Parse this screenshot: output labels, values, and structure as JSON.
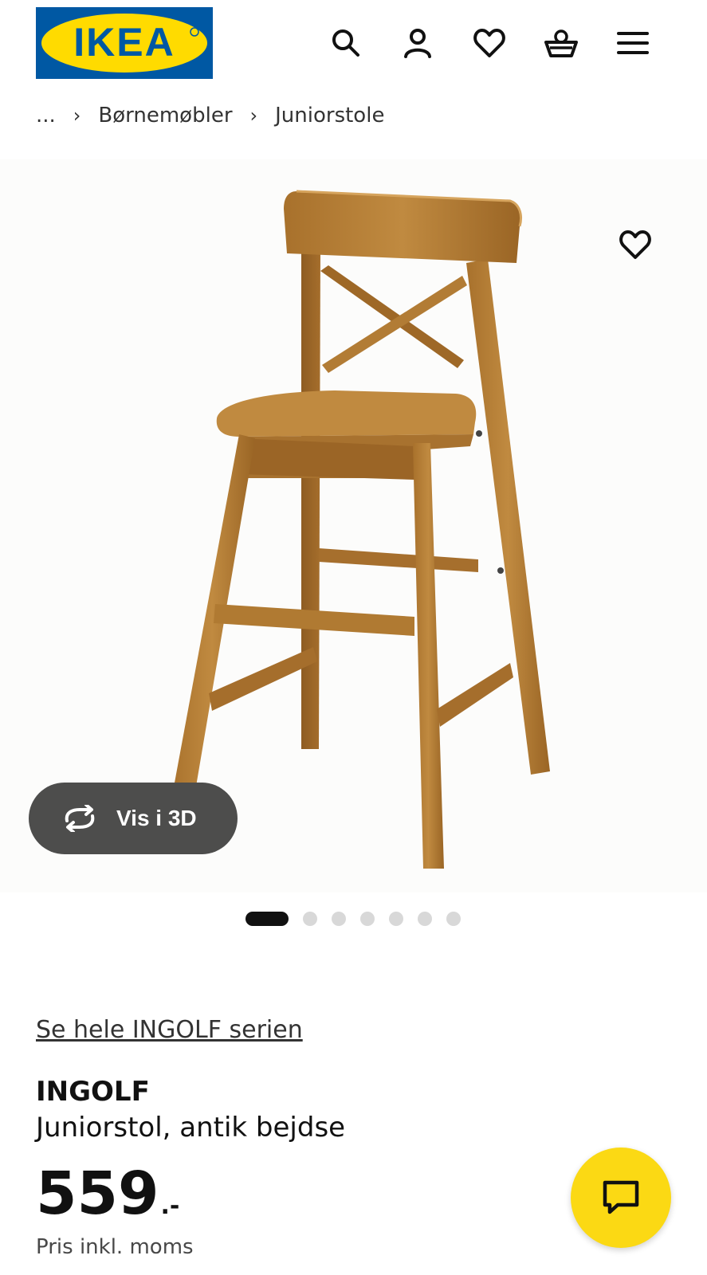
{
  "brand": {
    "logo_text": "IKEA",
    "colors": {
      "blue": "#0058a3",
      "yellow": "#ffdb00"
    }
  },
  "header": {
    "icons": [
      "search-icon",
      "account-icon",
      "heart-icon",
      "basket-icon",
      "menu-icon"
    ]
  },
  "breadcrumb": {
    "ellipsis": "...",
    "items": [
      "Børnemøbler",
      "Juniorstole"
    ]
  },
  "gallery": {
    "view_3d_label": "Vis i 3D",
    "slide_count": 7,
    "active_slide": 1
  },
  "product": {
    "series_link": "Se hele INGOLF serien",
    "name": "INGOLF",
    "description": "Juniorstol, antik bejdse",
    "price_integer": "559",
    "price_suffix": ".-",
    "price_note": "Pris inkl. moms"
  },
  "colors": {
    "accent_yellow": "#fbd914",
    "button_dark": "#4d4d4c",
    "wood": "#b07a32"
  }
}
